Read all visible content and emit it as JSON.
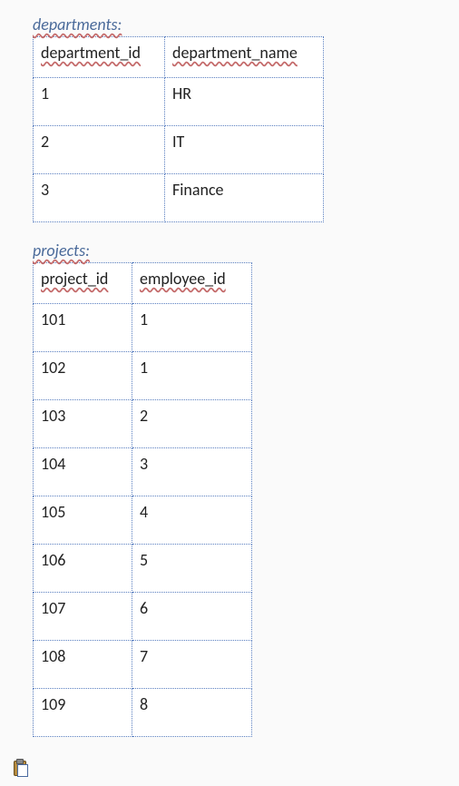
{
  "tables": {
    "departments": {
      "caption": "departments:",
      "headers": [
        "department_id",
        "department_name"
      ],
      "rows": [
        [
          "1",
          "HR"
        ],
        [
          "2",
          "IT"
        ],
        [
          "3",
          "Finance"
        ]
      ]
    },
    "projects": {
      "caption": "projects:",
      "headers": [
        "project_id",
        "employee_id"
      ],
      "rows": [
        [
          "101",
          "1"
        ],
        [
          "102",
          "1"
        ],
        [
          "103",
          "2"
        ],
        [
          "104",
          "3"
        ],
        [
          "105",
          "4"
        ],
        [
          "106",
          "5"
        ],
        [
          "107",
          "6"
        ],
        [
          "108",
          "7"
        ],
        [
          "109",
          "8"
        ]
      ]
    }
  },
  "chart_data": [
    {
      "type": "table",
      "title": "departments",
      "columns": [
        "department_id",
        "department_name"
      ],
      "rows": [
        [
          1,
          "HR"
        ],
        [
          2,
          "IT"
        ],
        [
          3,
          "Finance"
        ]
      ]
    },
    {
      "type": "table",
      "title": "projects",
      "columns": [
        "project_id",
        "employee_id"
      ],
      "rows": [
        [
          101,
          1
        ],
        [
          102,
          1
        ],
        [
          103,
          2
        ],
        [
          104,
          3
        ],
        [
          105,
          4
        ],
        [
          106,
          5
        ],
        [
          107,
          6
        ],
        [
          108,
          7
        ],
        [
          109,
          8
        ]
      ]
    }
  ]
}
